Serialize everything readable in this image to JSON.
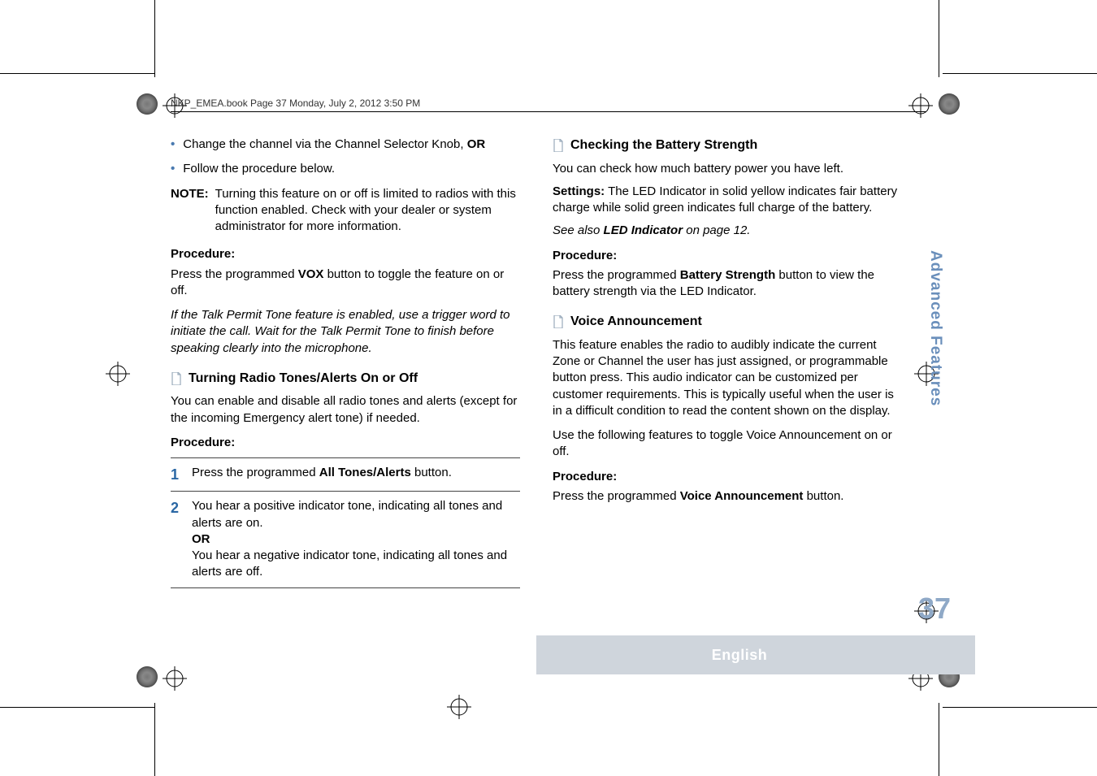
{
  "header": "NKP_EMEA.book  Page 37  Monday, July 2, 2012  3:50 PM",
  "left": {
    "bullet1_pre": "Change the channel via the Channel Selector Knob, ",
    "bullet1_or": "OR",
    "bullet2": "Follow the procedure below.",
    "note_label": "NOTE:",
    "note_text": "Turning this feature on or off is limited to radios with this function enabled. Check with your dealer or system administrator for more information.",
    "proc_label": "Procedure:",
    "vox_pre": "Press the programmed ",
    "vox_bold": "VOX",
    "vox_post": " button to toggle the feature on or off.",
    "talk_permit": "If the Talk Permit Tone feature is enabled, use a trigger word to initiate the call. Wait for the Talk Permit Tone to finish before speaking clearly into the microphone.",
    "tones_heading": "Turning Radio Tones/Alerts On or Off",
    "tones_intro": "You can enable and disable all radio tones and alerts (except for the incoming Emergency alert tone) if needed.",
    "tones_proc": "Procedure:",
    "step1_pre": "Press the programmed ",
    "step1_bold": "All Tones/Alerts",
    "step1_post": " button.",
    "step2_a": "You hear a positive indicator tone, indicating all tones and alerts are on.",
    "step2_or": "OR",
    "step2_b": "You hear a negative indicator tone, indicating all tones and alerts are off."
  },
  "right": {
    "battery_heading": "Checking the Battery Strength",
    "battery_intro": "You can check how much battery power you have left.",
    "settings_label": "Settings:",
    "settings_text": " The LED Indicator in solid yellow indicates fair battery charge while solid green indicates full charge of the battery.",
    "seealso_pre": "See also ",
    "seealso_bold": "LED Indicator",
    "seealso_post": " on page 12.",
    "battery_proc": "Procedure:",
    "battery_press_pre": "Press the programmed ",
    "battery_press_bold": "Battery Strength",
    "battery_press_post": " button to view the battery strength via the LED Indicator.",
    "voice_heading": "Voice Announcement",
    "voice_intro": "This feature enables the radio to audibly indicate the current Zone or Channel the user has just assigned, or programmable button press. This audio indicator can be customized per customer requirements. This is typically useful when the user is in a difficult condition to read the content shown on the display.",
    "voice_toggle": "Use the following features to toggle Voice Announcement on or off.",
    "voice_proc": "Procedure:",
    "voice_press_pre": "Press the programmed ",
    "voice_press_bold": "Voice Announcement",
    "voice_press_post": " button."
  },
  "sidebar": "Advanced Features",
  "page_number": "37",
  "footer_lang": "English"
}
